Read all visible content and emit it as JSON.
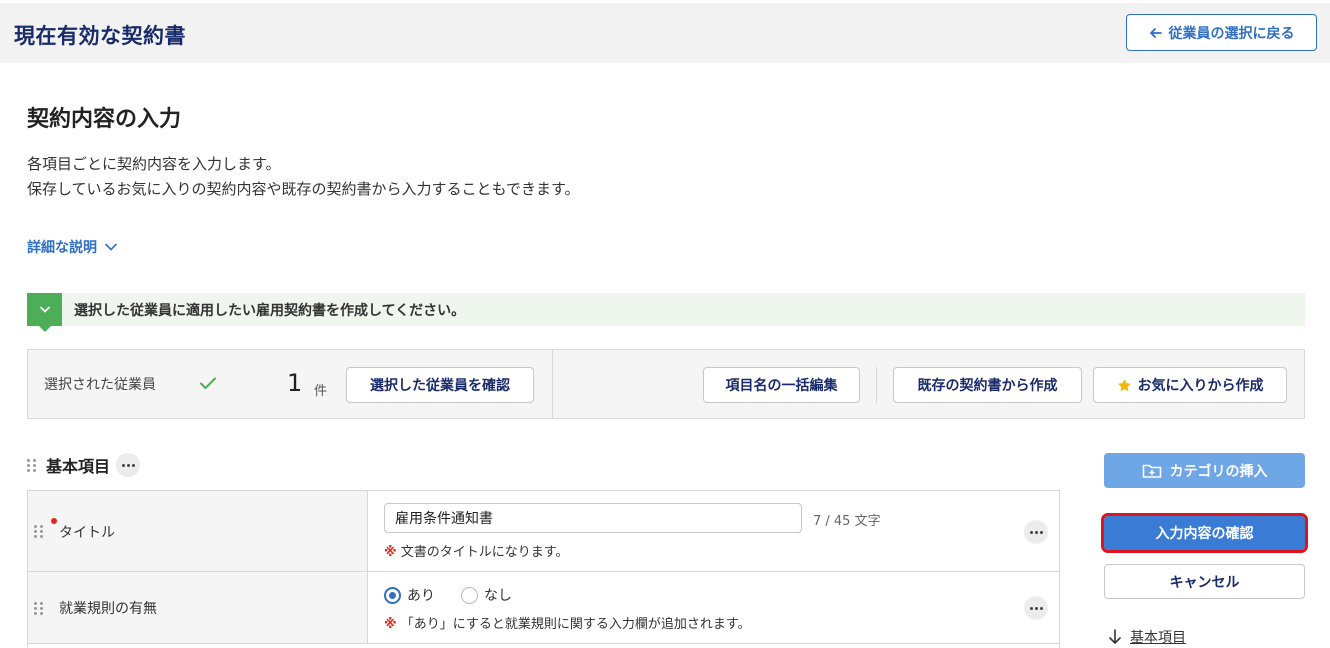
{
  "header": {
    "title": "現在有効な契約書",
    "back_label": "従業員の選択に戻る"
  },
  "heading": "契約内容の入力",
  "description": {
    "line1": "各項目ごとに契約内容を入力します。",
    "line2": "保存しているお気に入りの契約内容や既存の契約書から入力することもできます。"
  },
  "details_link": "詳細な説明",
  "banner": {
    "message": "選択した従業員に適用したい雇用契約書を作成してください。"
  },
  "employees": {
    "label": "選択された従業員",
    "count": "1",
    "unit": "件",
    "confirm_button": "選択した従業員を確認",
    "bulk_edit_button": "項目名の一括編集",
    "from_existing_button": "既存の契約書から作成",
    "from_favorites_button": "お気に入りから作成"
  },
  "section": {
    "title": "基本項目"
  },
  "rows": [
    {
      "label": "タイトル",
      "required": true,
      "value": "雇用条件通知書",
      "counter": "7 / 45 文字",
      "note_mark": "※",
      "note": "文書のタイトルになります。"
    },
    {
      "label": "就業規則の有無",
      "options": [
        "あり",
        "なし"
      ],
      "selected": "あり",
      "note_mark": "※",
      "note": "「あり」にすると就業規則に関する入力欄が追加されます。"
    }
  ],
  "sidebar": {
    "insert_category": "カテゴリの挿入",
    "confirm_input": "入力内容の確認",
    "cancel": "キャンセル",
    "anchor_basic": "基本項目"
  },
  "colors": {
    "navy": "#1a2b6b",
    "primary_blue": "#3a7bd5",
    "light_blue": "#6ea6e6",
    "green": "#4cae56",
    "highlight_red": "#e0141e"
  }
}
